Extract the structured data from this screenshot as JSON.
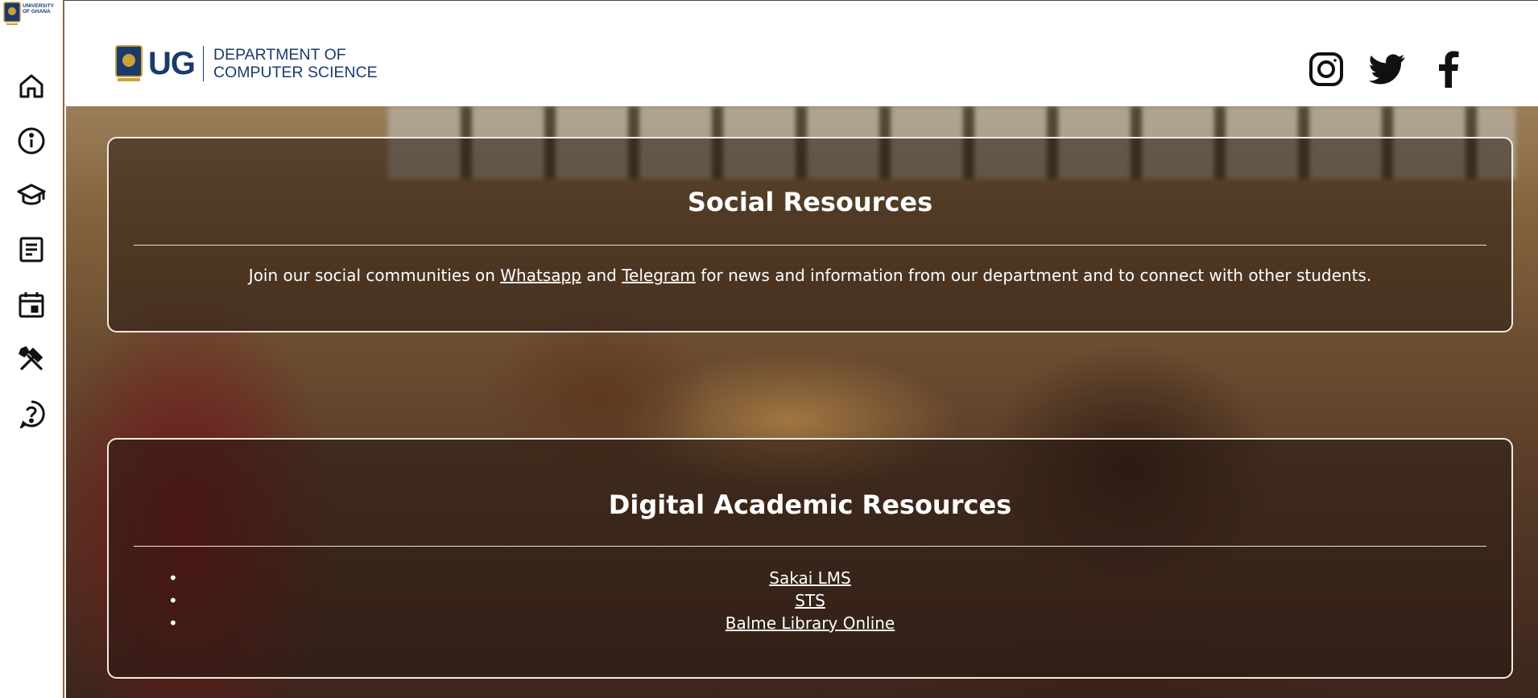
{
  "sidebar": {
    "logo_text": [
      "UNIVERSITY",
      "OF GHANA"
    ],
    "items": [
      {
        "name": "home-icon"
      },
      {
        "name": "info-icon"
      },
      {
        "name": "graduation-cap-icon"
      },
      {
        "name": "article-icon"
      },
      {
        "name": "calendar-icon"
      },
      {
        "name": "tools-icon"
      },
      {
        "name": "help-icon"
      }
    ]
  },
  "header": {
    "ug": "UG",
    "dept_line1": "DEPARTMENT OF",
    "dept_line2": "COMPUTER SCIENCE",
    "socials": [
      "instagram-icon",
      "twitter-icon",
      "facebook-icon"
    ]
  },
  "social_card": {
    "title": "Social Resources",
    "text_before": "Join our social communities on ",
    "link_whatsapp": "Whatsapp",
    "text_and": " and ",
    "link_telegram": "Telegram",
    "text_after": " for news and information from our department and to connect with other students."
  },
  "academic_card": {
    "title": "Digital Academic Resources",
    "links": [
      "Sakai LMS",
      "STS",
      "Balme Library Online"
    ]
  },
  "colors": {
    "brand_blue": "#1b3a6b",
    "card_border": "#f1ece4",
    "sidebar_border": "#8a6a3a"
  }
}
